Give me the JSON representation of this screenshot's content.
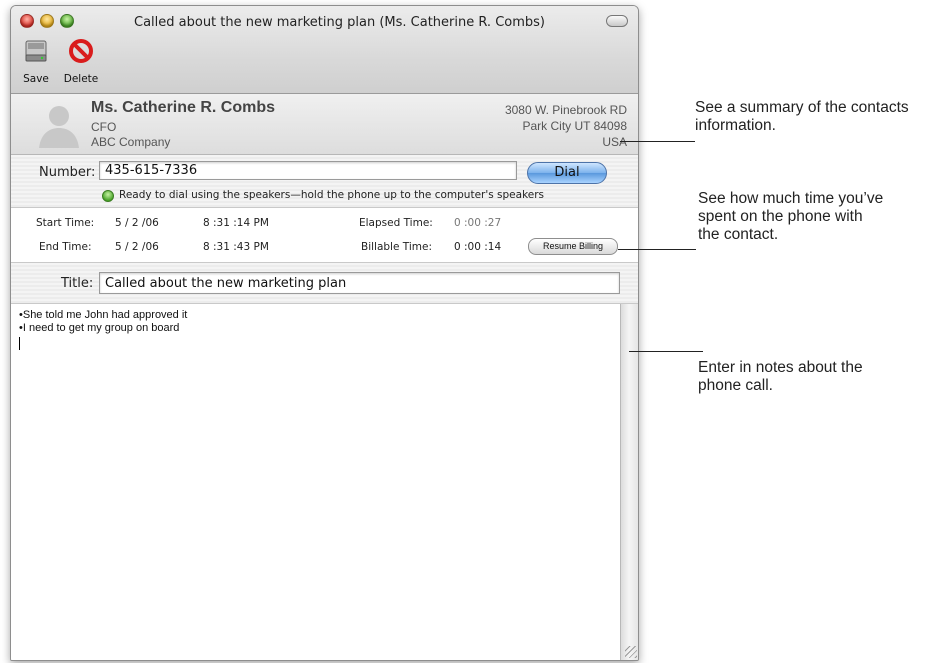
{
  "window": {
    "title": "Called about the new marketing plan (Ms. Catherine R. Combs)"
  },
  "toolbar": {
    "save_label": "Save",
    "delete_label": "Delete"
  },
  "contact": {
    "name": "Ms. Catherine R. Combs",
    "job_title": "CFO",
    "company": "ABC Company",
    "address_line1": "3080 W. Pinebrook RD",
    "address_line2": "Park City UT 84098",
    "country": "USA"
  },
  "phone": {
    "number_label": "Number:",
    "number_value": "435-615-7336",
    "dial_label": "Dial",
    "status_text": "Ready to dial using the speakers—hold the phone up to the computer's speakers"
  },
  "timing": {
    "start_label": "Start Time:",
    "start_date": "5 / 2 /06",
    "start_time": "8 :31 :14 PM",
    "end_label": "End Time:",
    "end_date": "5 / 2 /06",
    "end_time": "8 :31 :43 PM",
    "elapsed_label": "Elapsed Time:",
    "elapsed_value": "0 :00 :27",
    "billable_label": "Billable Time:",
    "billable_value": "0 :00 :14",
    "resume_label": "Resume Billing"
  },
  "call": {
    "title_label": "Title:",
    "title_value": "Called about the new marketing plan",
    "notes": [
      "•She told me John had approved it",
      "•I need to get my group on board"
    ]
  },
  "callouts": {
    "summary_line1": "See a summary of the contacts",
    "summary_line2": "information.",
    "time_line1": "See how much time you’ve",
    "time_line2": "spent on the phone with",
    "time_line3": "the contact.",
    "notes_line1": "Enter in notes about the",
    "notes_line2": "phone call."
  },
  "colors": {
    "dial_button": "#7cb2ec",
    "status_dot": "#4aa52a",
    "close_button": "#d8322a",
    "minimize_button": "#e0a81e",
    "zoom_button": "#4ca32b"
  },
  "icons": {
    "save": "disk-drive-icon",
    "delete": "no-symbol-icon",
    "avatar": "person-silhouette-icon"
  }
}
